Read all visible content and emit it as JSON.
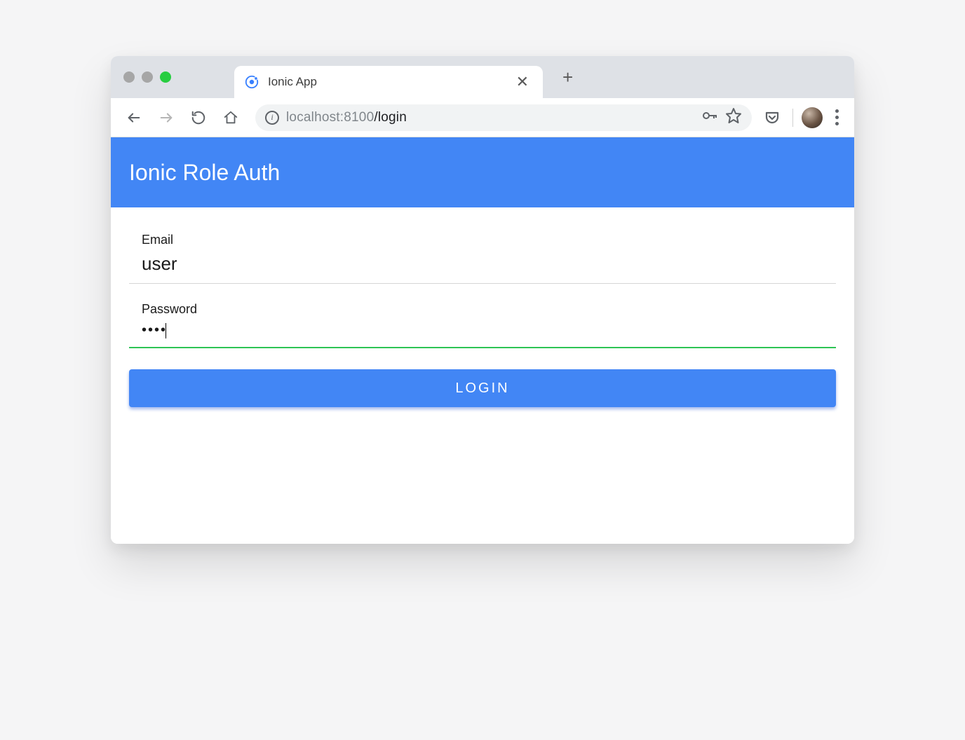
{
  "browser": {
    "tab_title": "Ionic App",
    "url_host": "localhost",
    "url_port": ":8100",
    "url_path": "/login"
  },
  "app": {
    "header_title": "Ionic Role Auth"
  },
  "form": {
    "email_label": "Email",
    "email_value": "user",
    "password_label": "Password",
    "password_value": "••••",
    "login_button": "LOGIN"
  }
}
